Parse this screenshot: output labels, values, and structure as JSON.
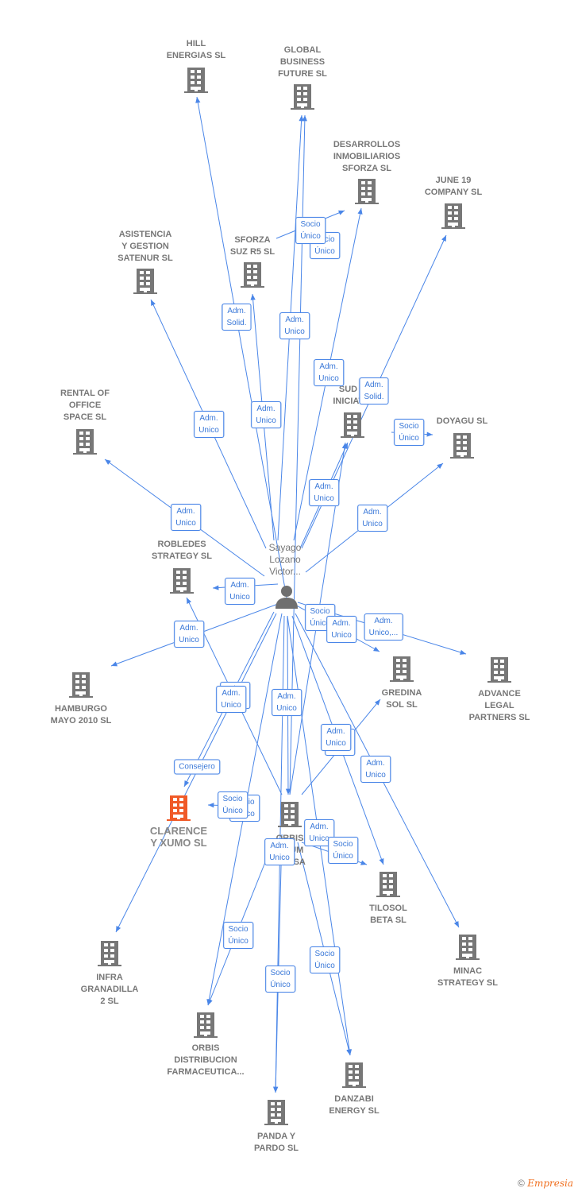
{
  "center_person": {
    "name_lines": [
      "Sayago",
      "Lozano",
      "Victor..."
    ],
    "icon": "person-icon"
  },
  "nodes": [
    {
      "id": "hill",
      "lines": [
        "HILL",
        "ENERGIAS  SL"
      ]
    },
    {
      "id": "global",
      "lines": [
        "GLOBAL",
        "BUSINESS",
        "FUTURE SL"
      ]
    },
    {
      "id": "desarrollos",
      "lines": [
        "DESARROLLOS",
        "INMOBILIARIOS",
        "SFORZA  SL"
      ]
    },
    {
      "id": "june",
      "lines": [
        "JUNE 19",
        "COMPANY  SL"
      ]
    },
    {
      "id": "asistencia",
      "lines": [
        "ASISTENCIA",
        "Y GESTION",
        "SATENUR  SL"
      ]
    },
    {
      "id": "sforza",
      "lines": [
        "SFORZA",
        "SUZ R5  SL"
      ]
    },
    {
      "id": "rental",
      "lines": [
        "RENTAL OF",
        "OFFICE",
        "SPACE  SL"
      ]
    },
    {
      "id": "sud",
      "lines": [
        "SUD D",
        "INICIATIV"
      ]
    },
    {
      "id": "doyagu",
      "lines": [
        "DOYAGU  SL"
      ]
    },
    {
      "id": "robledes",
      "lines": [
        "ROBLEDES",
        "STRATEGY  SL"
      ]
    },
    {
      "id": "hamburgo",
      "lines": [
        "HAMBURGO",
        "MAYO 2010 SL"
      ]
    },
    {
      "id": "gredina",
      "lines": [
        "GREDINA",
        "SOL  SL"
      ]
    },
    {
      "id": "advance",
      "lines": [
        "ADVANCE",
        "LEGAL",
        "PARTNERS  SL"
      ]
    },
    {
      "id": "clarence",
      "lines": [
        "CLARENCE",
        "Y XUMO  SL"
      ]
    },
    {
      "id": "orbis",
      "lines": [
        "ORBIS",
        "L     RUM",
        "S     KI SA"
      ]
    },
    {
      "id": "tilosol",
      "lines": [
        "TILOSOL",
        "BETA  SL"
      ]
    },
    {
      "id": "infra",
      "lines": [
        "INFRA",
        "GRANADILLA",
        "2  SL"
      ]
    },
    {
      "id": "minac",
      "lines": [
        "MINAC",
        "STRATEGY  SL"
      ]
    },
    {
      "id": "orbisdist",
      "lines": [
        "ORBIS",
        "DISTRIBUCION",
        "FARMACEUTICA..."
      ]
    },
    {
      "id": "danzabi",
      "lines": [
        "DANZABI",
        "ENERGY  SL"
      ]
    },
    {
      "id": "panda",
      "lines": [
        "PANDA Y",
        "PARDO  SL"
      ]
    }
  ],
  "relation_labels": [
    "Socio Único",
    "Socio Único",
    "Adm. Solid.",
    "Adm. Unico",
    "Adm. Unico",
    "Adm. Solid.",
    "Adm. Unico",
    "Adm. Unico",
    "Socio Único",
    "Adm. Unico",
    "Adm. Unico",
    "Adm. Unico",
    "Adm. Unico",
    "Adm. Unico",
    "Socio Único",
    "Adm. Unico",
    "Adm. Unico,...",
    "Adm. Unico",
    "Adm. Unico",
    "Adm. Unico",
    "Consejero",
    "Socio Único",
    "Adm. Unico",
    "Adm. Unico",
    "Socio Único",
    "Socio Único",
    "Adm. Unico",
    "Adm. Unico",
    "Socio Único",
    "Socio Único",
    "Socio Único",
    "Socio Único"
  ],
  "colors": {
    "edge": "#4a86e8",
    "company": "#777777",
    "highlight": "#f05a28"
  },
  "footer": {
    "copyright": "©",
    "brand": "Empresia"
  }
}
